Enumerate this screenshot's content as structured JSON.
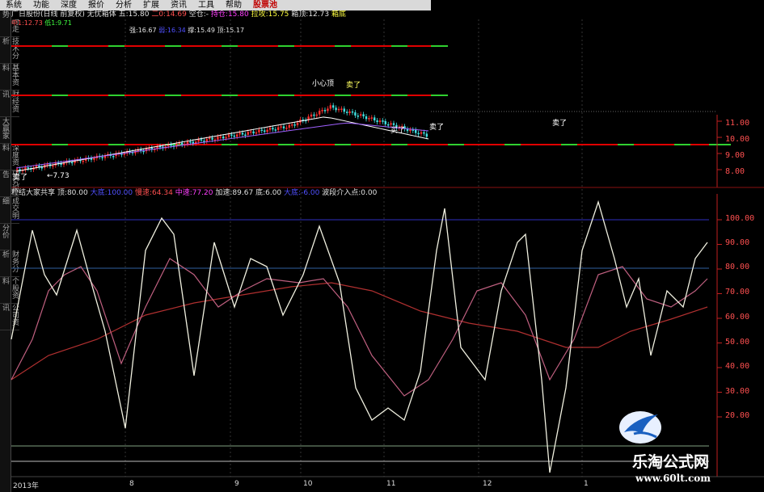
{
  "menu": [
    "系统",
    "功能",
    "深度",
    "报价",
    "分析",
    "扩展",
    "资讯",
    "工具",
    "帮助",
    "股票池"
  ],
  "sidebar_tabs": [
    "分时走势",
    "技术分析",
    "基本资料",
    "财经资讯",
    "大赢家",
    "深度资料",
    "研究报告",
    "成交明细",
    "分价",
    "财务分析",
    "个股资料",
    "公司资讯"
  ],
  "stock_info": {
    "name": "广日股份(日线 前复权) 无忧箱体",
    "wu_label": "五:",
    "wu_val": "15.80",
    "er_label": "二0:",
    "er_val": "14.69",
    "kong_label": "空仓:",
    "kong_val": "-",
    "bomu_label": "持仓:",
    "bomu_val": "15.80",
    "ladong_label": "拉攻:",
    "ladong_val": "15.75",
    "xiangding_label": "箱顶:",
    "xiangding_val": "12.73",
    "xiangdi_label": "箱底",
    "xiangdi_val": ""
  },
  "stock_info2": {
    "zhong_label": "中1:",
    "zhong_val": "12.73",
    "di_label": "低1:",
    "di_val": "9.71"
  },
  "stock_info3": {
    "qiang_label": "强:",
    "qiang_val": "16.67",
    "ruo_label": "弱:",
    "ruo_val": "16.34",
    "zhi_label": "撑:",
    "zhi_val": "15.49",
    "ya_label": "顶:",
    "ya_val": "15.17"
  },
  "annotations": {
    "xiaoxin": "小心顶",
    "mai1": "卖了",
    "mai2": "卖了",
    "mai3": "卖了",
    "maile": "买了",
    "low": "←7.73"
  },
  "indicator": {
    "name": "粒结大家共享",
    "v1_label": "顶:",
    "v1": "80.00",
    "v2_label": "大底:",
    "v2": "100.00",
    "v3_label": "慢速:",
    "v3": "64.34",
    "v4_label": "中速:",
    "v4": "77.20",
    "v5_label": "加速:",
    "v5": "89.67",
    "v6_label": "底:",
    "v6": "6.00",
    "v7_label": "大底:",
    "v7": "-6.00",
    "v8_label": "波段介入点:",
    "v8": "0.00"
  },
  "price_axis": [
    "11.00",
    "10.00",
    "9.00",
    "8.00"
  ],
  "ind_axis": [
    "100.00",
    "90.00",
    "80.00",
    "70.00",
    "60.00",
    "50.00",
    "40.00",
    "30.00",
    "20.00"
  ],
  "time_axis": [
    "2013年",
    "8",
    "9",
    "10",
    "11",
    "12",
    "1"
  ],
  "watermark": {
    "title": "乐淘公式网",
    "url": "www.60lt.com"
  },
  "colors": {
    "up": "#ff3030",
    "down": "#40e0e0",
    "box_red": "#e00000",
    "box_green": "#30d030",
    "fast": "#f0f0e0",
    "mid": "#c06080",
    "slow": "#b03030"
  }
}
